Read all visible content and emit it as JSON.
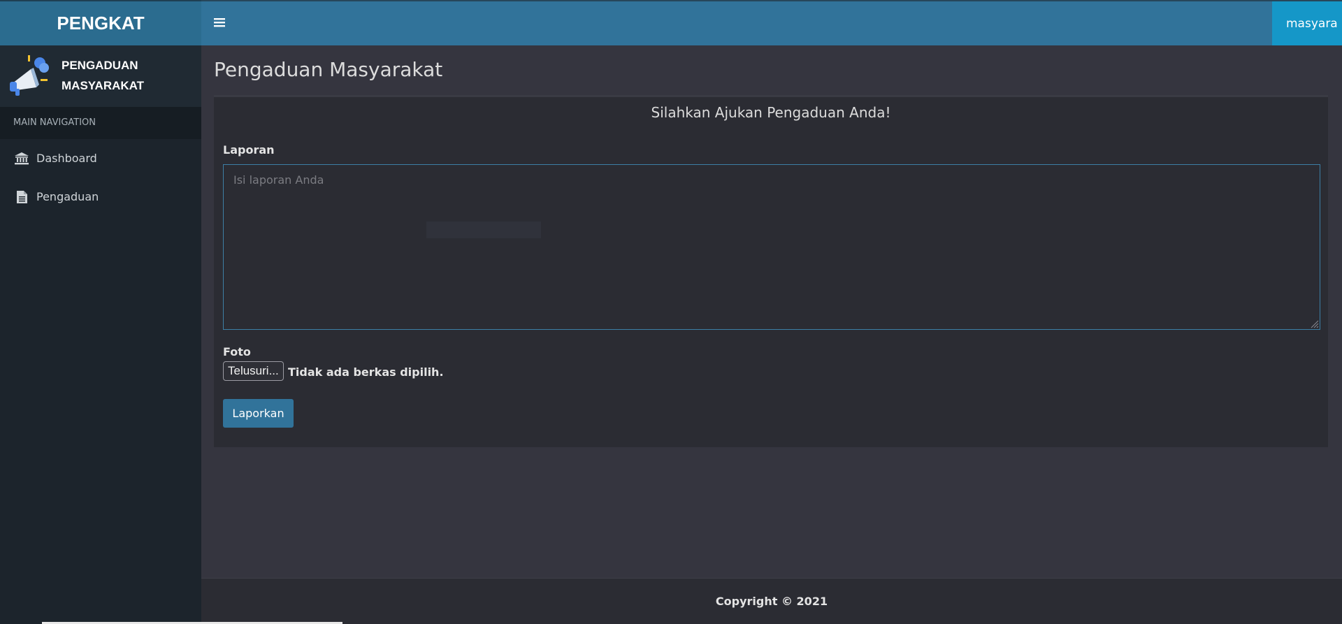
{
  "header": {
    "logo_text": "PENGKAT",
    "toggle_icon": "bars-icon",
    "user_label": "masyara"
  },
  "sidebar": {
    "brand_line1": "PENGADUAN",
    "brand_line2": "MASYARAKAT",
    "nav_header": "MAIN NAVIGATION",
    "items": [
      {
        "label": "Dashboard",
        "icon": "bank-icon"
      },
      {
        "label": "Pengaduan",
        "icon": "file-text-icon"
      }
    ]
  },
  "main": {
    "page_title": "Pengaduan Masyarakat",
    "box_title": "Silahkan Ajukan Pengaduan Anda!",
    "laporan_label": "Laporan",
    "laporan_placeholder": "Isi laporan Anda",
    "foto_label": "Foto",
    "file_button": "Telusuri...",
    "file_status": "Tidak ada berkas dipilih.",
    "submit_label": "Laporkan"
  },
  "footer": {
    "copyright": "Copyright © 2021"
  },
  "colors": {
    "header_blue": "#31739a",
    "user_menu": "#1597c8",
    "sidebar_bg": "#1c242c",
    "content_bg": "#35353f"
  }
}
